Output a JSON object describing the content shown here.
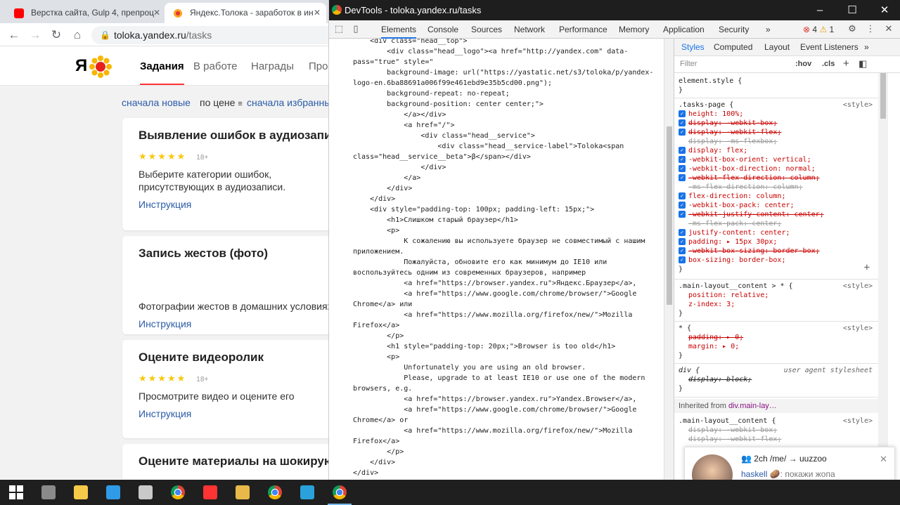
{
  "browser": {
    "tabs": [
      {
        "title": "Верстка сайта, Gulp 4, препроц",
        "icon": "youtube-icon",
        "color": "#ff0000"
      },
      {
        "title": "Яндекс.Толока - заработок в ин",
        "icon": "toloka-icon",
        "color": "#f9a825"
      }
    ],
    "url_host": "toloka.yandex.ru",
    "url_path": "/tasks"
  },
  "page": {
    "logo": "Я",
    "nav": [
      "Задания",
      "В работе",
      "Награды",
      "Про"
    ],
    "filters": [
      "сначала новые",
      "по цене",
      "сначала избранны"
    ],
    "cards": [
      {
        "title": "Выявление ошибок в аудиозаписи",
        "stars": "★★★★★",
        "age": "18+",
        "desc": "Выберите категории ошибок, присутствующих в аудиозаписи.",
        "link": "Инструкция"
      },
      {
        "title": "Запись жестов (фото)",
        "stars": "",
        "age": "",
        "desc": "Фотографии жестов в домашних условиях.",
        "link": "Инструкция"
      },
      {
        "title": "Оцените видеоролик",
        "stars": "★★★★★",
        "age": "18+",
        "desc": "Просмотрите видео и оцените его",
        "link": "Инструкция"
      },
      {
        "title": "Оцените материалы на шокирую",
        "stars": "",
        "age": "",
        "desc": "",
        "link": ""
      }
    ]
  },
  "devtools": {
    "title": "DevTools - toloka.yandex.ru/tasks",
    "tabs": [
      "Elements",
      "Console",
      "Sources",
      "Network",
      "Performance",
      "Memory",
      "Application",
      "Security",
      "»"
    ],
    "errors": "4",
    "warnings": "1",
    "code_lines": [
      "    <div class=\"head__top\">",
      "        <div class=\"head__logo\"><a href=\"http://yandex.com\" data-",
      "pass=\"true\" style=\"",
      "        background-image: url(\"https://yastatic.net/s3/toloka/p/yandex-",
      "logo-en.6ba88691a006f99e461ebd9e35b5cd00.png\");",
      "        background-repeat: no-repeat;",
      "        background-position: center center;\">",
      "            </a></div>",
      "            <a href=\"/\">",
      "                <div class=\"head__service\">",
      "                    <div class=\"head__service-label\">Toloka<span",
      "class=\"head__service__beta\">β</span></div>",
      "                </div>",
      "            </a>",
      "        </div>",
      "    </div>",
      "    <div style=\"padding-top: 100px; padding-left: 15px;\">",
      "        <h1>Слишком старый браузер</h1>",
      "        <p>",
      "            К сожалению вы используете браузер не совместимый с нашим",
      "приложением.",
      "            Пожалуйста, обновите его как минимум до IE10 или",
      "воспользуйтесь одним из современных браузеров, например",
      "            <a href=\"https://browser.yandex.ru\">Яндекс.Браузер</a>,",
      "            <a href=\"https://www.google.com/chrome/browser/\">Google",
      "Chrome</a> или",
      "            <a href=\"https://www.mozilla.org/firefox/new/\">Mozilla",
      "Firefox</a>",
      "        </p>",
      "        <h1 style=\"padding-top: 20px;\">Browser is too old</h1>",
      "        <p>",
      "            Unfortunately you are using an old browser.",
      "            Please, upgrade to at least IE10 or use one of the modern",
      "browsers, e.g.",
      "            <a href=\"https://browser.yandex.ru\">Yandex.Browser</a>,",
      "            <a href=\"https://www.google.com/chrome/browser/\">Google",
      "Chrome</a> or",
      "            <a href=\"https://www.mozilla.org/firefox/new/\">Mozilla",
      "Firefox</a>",
      "        </p>",
      "    </div>",
      "</div>"
    ],
    "styles": {
      "tabs": [
        "Styles",
        "Computed",
        "Layout",
        "Event Listeners",
        "»"
      ],
      "filter_placeholder": "Filter",
      "hov": ":hov",
      "cls": ".cls",
      "element_style": "element.style {",
      "tasks_selector": ".tasks-page {",
      "source": "<style>",
      "tasks_decls": [
        {
          "text": "height: 100%;",
          "cb": true,
          "strike": false
        },
        {
          "text": "display: -webkit-box;",
          "cb": true,
          "strike": true
        },
        {
          "text": "display: -webkit-flex;",
          "cb": true,
          "strike": true
        },
        {
          "text": "display: -ms-flexbox;",
          "cb": false,
          "strike": true
        },
        {
          "text": "display: flex;",
          "cb": true,
          "strike": false
        },
        {
          "text": "-webkit-box-orient: vertical;",
          "cb": true,
          "strike": false
        },
        {
          "text": "-webkit-box-direction: normal;",
          "cb": true,
          "strike": false
        },
        {
          "text": "-webkit-flex-direction: column;",
          "cb": true,
          "strike": true
        },
        {
          "text": "-ms-flex-direction: column;",
          "cb": false,
          "strike": true
        },
        {
          "text": "flex-direction: column;",
          "cb": true,
          "strike": false
        },
        {
          "text": "-webkit-box-pack: center;",
          "cb": true,
          "strike": false
        },
        {
          "text": "-webkit-justify-content: center;",
          "cb": true,
          "strike": true
        },
        {
          "text": "-ms-flex-pack: center;",
          "cb": false,
          "strike": true
        },
        {
          "text": "justify-content: center;",
          "cb": true,
          "strike": false
        },
        {
          "text": "padding: ▸ 15px 30px;",
          "cb": true,
          "strike": false
        },
        {
          "text": "-webkit-box-sizing: border-box;",
          "cb": true,
          "strike": true
        },
        {
          "text": "box-sizing: border-box;",
          "cb": true,
          "strike": false
        }
      ],
      "main_selector": ".main-layout__content > * {",
      "main_decls": [
        "position: relative;",
        "z-index: 3;"
      ],
      "star_selector": "* {",
      "star_decls": [
        "padding: ▸ 0;",
        "margin: ▸ 0;"
      ],
      "div_selector": "div {",
      "ua_label": "user agent stylesheet",
      "div_decl": "display: block;",
      "inherited_label": "Inherited from",
      "inherited_from": "div.main-lay…",
      "main2_selector": ".main-layout__content {",
      "main2_decls": [
        "display: -webkit-box;",
        "display: -webkit-flex;"
      ],
      "close_brace": "}"
    }
  },
  "notification": {
    "header": "2ch /me/ → uuzzoo",
    "sender": "haskell",
    "message": ": покажи жопа"
  },
  "taskbar": [
    "windows-start-icon",
    "file-explorer-icon",
    "sticky-notes-icon",
    "vscode-icon",
    "paint-icon",
    "chrome-icon",
    "yandex-browser-icon",
    "folder-icon",
    "chrome-icon",
    "telegram-icon",
    "chrome-active-icon"
  ]
}
